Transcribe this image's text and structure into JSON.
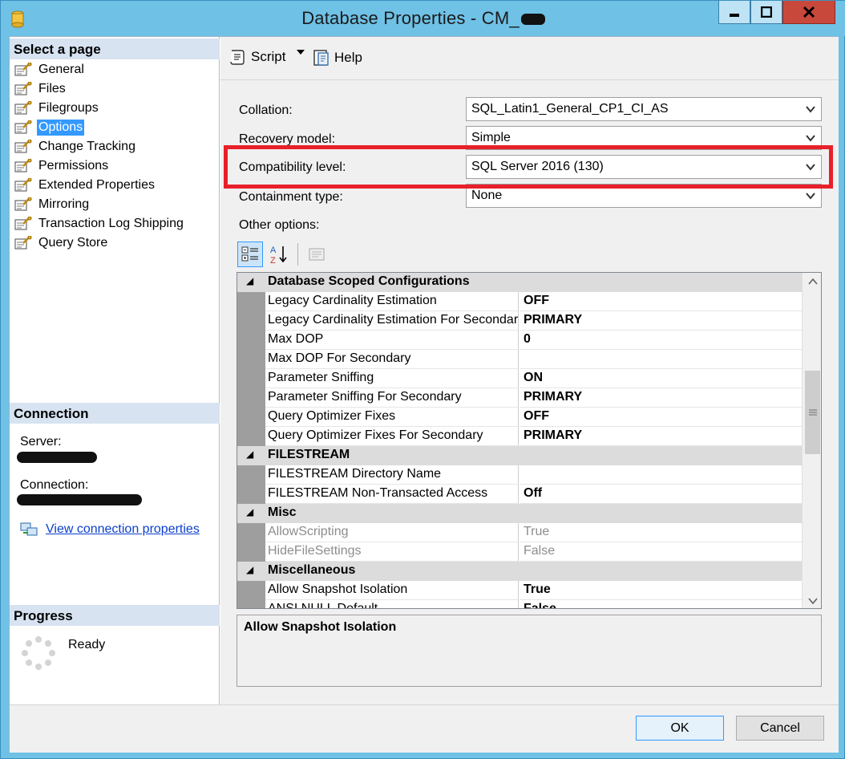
{
  "window": {
    "title": "Database Properties - CM_",
    "title_redacted": true,
    "controls": {
      "minimize": "minimize",
      "maximize": "maximize",
      "close": "close"
    }
  },
  "left_pane": {
    "select_page_header": "Select a page",
    "pages": [
      {
        "label": "General",
        "selected": false
      },
      {
        "label": "Files",
        "selected": false
      },
      {
        "label": "Filegroups",
        "selected": false
      },
      {
        "label": "Options",
        "selected": true
      },
      {
        "label": "Change Tracking",
        "selected": false
      },
      {
        "label": "Permissions",
        "selected": false
      },
      {
        "label": "Extended Properties",
        "selected": false
      },
      {
        "label": "Mirroring",
        "selected": false
      },
      {
        "label": "Transaction Log Shipping",
        "selected": false
      },
      {
        "label": "Query Store",
        "selected": false
      }
    ],
    "connection_header": "Connection",
    "server_label": "Server:",
    "connection_label": "Connection:",
    "view_connection_link": "View connection properties",
    "progress_header": "Progress",
    "progress_status": "Ready"
  },
  "toolbar": {
    "script_label": "Script",
    "help_label": "Help"
  },
  "options": {
    "collation_label": "Collation:",
    "collation_value": "SQL_Latin1_General_CP1_CI_AS",
    "recovery_label": "Recovery model:",
    "recovery_value": "Simple",
    "compat_label": "Compatibility level:",
    "compat_value": "SQL Server 2016 (130)",
    "containment_label": "Containment type:",
    "containment_value": "None",
    "other_options_label": "Other options:"
  },
  "property_grid": {
    "categories": [
      {
        "name": "Database Scoped Configurations",
        "rows": [
          {
            "name": "Legacy Cardinality Estimation",
            "value": "OFF"
          },
          {
            "name": "Legacy Cardinality Estimation For Secondary",
            "value": "PRIMARY"
          },
          {
            "name": "Max DOP",
            "value": "0"
          },
          {
            "name": "Max DOP For Secondary",
            "value": ""
          },
          {
            "name": "Parameter Sniffing",
            "value": "ON"
          },
          {
            "name": "Parameter Sniffing For Secondary",
            "value": "PRIMARY"
          },
          {
            "name": "Query Optimizer Fixes",
            "value": "OFF"
          },
          {
            "name": "Query Optimizer Fixes For Secondary",
            "value": "PRIMARY"
          }
        ]
      },
      {
        "name": "FILESTREAM",
        "rows": [
          {
            "name": "FILESTREAM Directory Name",
            "value": ""
          },
          {
            "name": "FILESTREAM Non-Transacted Access",
            "value": "Off"
          }
        ]
      },
      {
        "name": "Misc",
        "rows": [
          {
            "name": "AllowScripting",
            "value": "True",
            "disabled": true
          },
          {
            "name": "HideFileSettings",
            "value": "False",
            "disabled": true
          }
        ]
      },
      {
        "name": "Miscellaneous",
        "rows": [
          {
            "name": "Allow Snapshot Isolation",
            "value": "True"
          },
          {
            "name": "ANSI NULL Default",
            "value": "False"
          }
        ]
      }
    ],
    "description_title": "Allow Snapshot Isolation"
  },
  "footer": {
    "ok_label": "OK",
    "cancel_label": "Cancel"
  },
  "colors": {
    "title_bar": "#6fc1e6",
    "close_button": "#c9483c",
    "selection": "#3399ff",
    "highlight_box": "#e8202a",
    "section_header": "#d7e3f1"
  }
}
